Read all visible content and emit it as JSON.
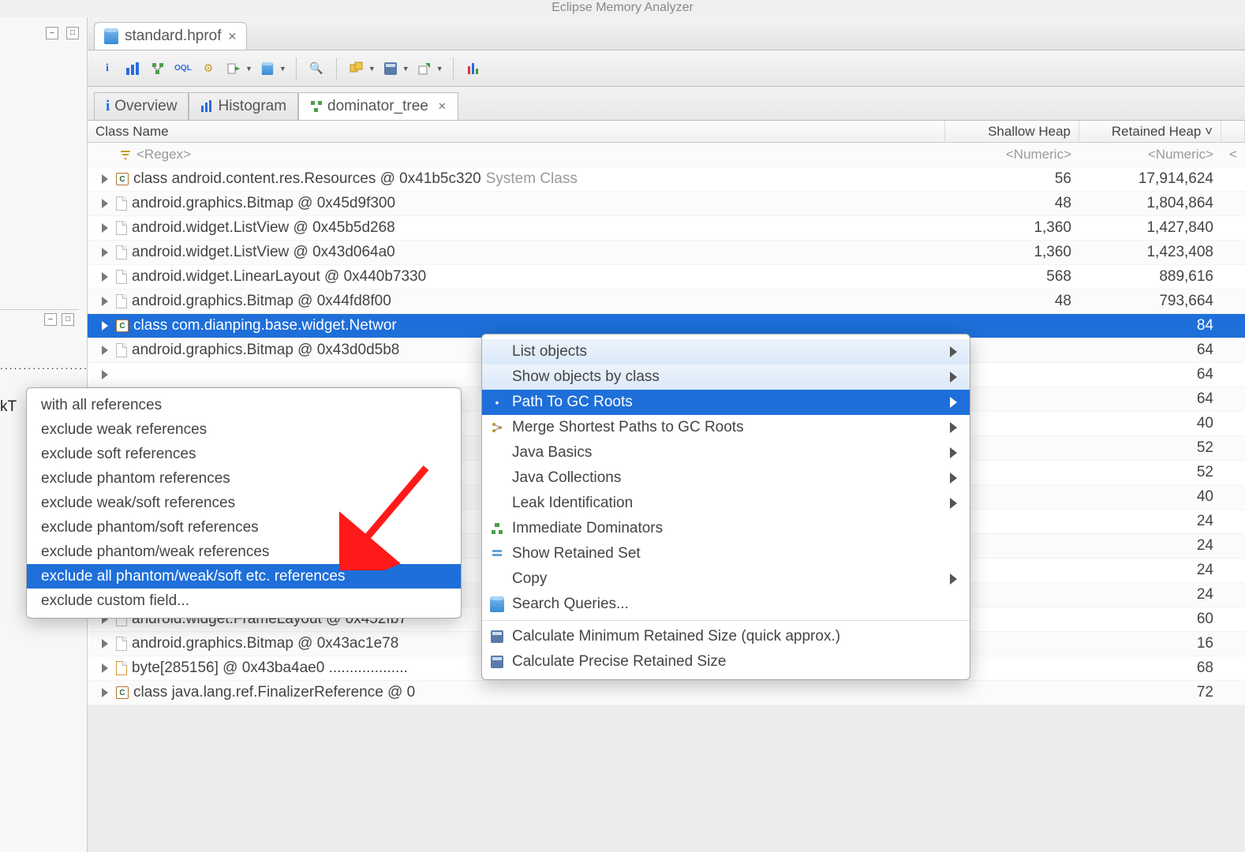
{
  "app_title": "Eclipse Memory Analyzer",
  "file_tab": {
    "label": "standard.hprof"
  },
  "view_tabs": [
    {
      "label": "Overview"
    },
    {
      "label": "Histogram"
    },
    {
      "label": "dominator_tree"
    }
  ],
  "columns": {
    "c0": "Class Name",
    "c1": "Shallow Heap",
    "c2": "Retained Heap",
    "c2_sort": "˅"
  },
  "filters": {
    "c0": "<Regex>",
    "c1": "<Numeric>",
    "c2": "<Numeric>",
    "c3": "<"
  },
  "rows": [
    {
      "name": "class android.content.res.Resources @ 0x41b5c320",
      "suffix": "System Class",
      "icon": "class",
      "sh": "56",
      "rh": "17,914,624"
    },
    {
      "name": "android.graphics.Bitmap @ 0x45d9f300",
      "icon": "doc",
      "sh": "48",
      "rh": "1,804,864"
    },
    {
      "name": "android.widget.ListView @ 0x45b5d268",
      "icon": "doc",
      "sh": "1,360",
      "rh": "1,427,840"
    },
    {
      "name": "android.widget.ListView @ 0x43d064a0",
      "icon": "doc",
      "sh": "1,360",
      "rh": "1,423,408"
    },
    {
      "name": "android.widget.LinearLayout @ 0x440b7330",
      "icon": "doc",
      "sh": "568",
      "rh": "889,616"
    },
    {
      "name": "android.graphics.Bitmap @ 0x44fd8f00",
      "icon": "doc",
      "sh": "48",
      "rh": "793,664"
    },
    {
      "name": "class com.dianping.base.widget.Networ",
      "icon": "class",
      "sh": "",
      "rh": "84",
      "selected": true
    },
    {
      "name": "android.graphics.Bitmap @ 0x43d0d5b8",
      "icon": "doc",
      "sh": "",
      "rh": "64"
    },
    {
      "name": "",
      "icon": "",
      "sh": "",
      "rh": "64"
    },
    {
      "name": "",
      "icon": "",
      "sh": "",
      "rh": "64"
    },
    {
      "name": "",
      "icon": "",
      "sh": "",
      "rh": "40"
    },
    {
      "name": "",
      "icon": "",
      "sh": "",
      "rh": "52"
    },
    {
      "name": "",
      "icon": "",
      "sh": "",
      "rh": "52"
    },
    {
      "name": "",
      "icon": "",
      "sh": "",
      "rh": "40"
    },
    {
      "name": "",
      "icon": "",
      "sh": "",
      "rh": "24"
    },
    {
      "name": "",
      "icon": "",
      "sh": "",
      "rh": "24"
    },
    {
      "name": "",
      "icon": "",
      "sh": "",
      "rh": "24"
    },
    {
      "name": "",
      "icon": "",
      "sh": "",
      "rh": "24"
    },
    {
      "name": "android.widget.FrameLayout @ 0x452fb7",
      "icon": "doc",
      "sh": "",
      "rh": "60"
    },
    {
      "name": "android.graphics.Bitmap @ 0x43ac1e78",
      "icon": "doc",
      "sh": "",
      "rh": "16"
    },
    {
      "name": "byte[285156] @ 0x43ba4ae0  ...................",
      "icon": "byte",
      "sh": "",
      "rh": "68"
    },
    {
      "name": "class java.lang.ref.FinalizerReference @ 0",
      "icon": "class",
      "sh": "",
      "rh": "72"
    }
  ],
  "context_menu": [
    {
      "label": "List objects",
      "arrow": true,
      "header": true
    },
    {
      "label": "Show objects by class",
      "arrow": true,
      "header": true
    },
    {
      "label": "Path To GC Roots",
      "arrow": true,
      "selected": true,
      "icon": "gc"
    },
    {
      "label": "Merge Shortest Paths to GC Roots",
      "arrow": true,
      "icon": "merge"
    },
    {
      "label": "Java Basics",
      "arrow": true
    },
    {
      "label": "Java Collections",
      "arrow": true
    },
    {
      "label": "Leak Identification",
      "arrow": true
    },
    {
      "label": "Immediate Dominators",
      "icon": "dom"
    },
    {
      "label": "Show Retained Set",
      "icon": "ret"
    },
    {
      "label": "Copy",
      "arrow": true
    },
    {
      "label": "Search Queries...",
      "icon": "search"
    },
    {
      "sep": true
    },
    {
      "label": "Calculate Minimum Retained Size (quick approx.)",
      "icon": "calc"
    },
    {
      "label": "Calculate Precise Retained Size",
      "icon": "calc"
    }
  ],
  "sub_menu": [
    {
      "label": "with all references"
    },
    {
      "label": "exclude weak references"
    },
    {
      "label": "exclude soft references"
    },
    {
      "label": "exclude phantom references"
    },
    {
      "label": "exclude weak/soft references"
    },
    {
      "label": "exclude phantom/soft references"
    },
    {
      "label": "exclude phantom/weak references"
    },
    {
      "label": "exclude all phantom/weak/soft etc. references",
      "selected": true
    },
    {
      "label": "exclude custom field..."
    }
  ],
  "left_text": {
    "kt": "kT",
    "dots": "......................."
  }
}
